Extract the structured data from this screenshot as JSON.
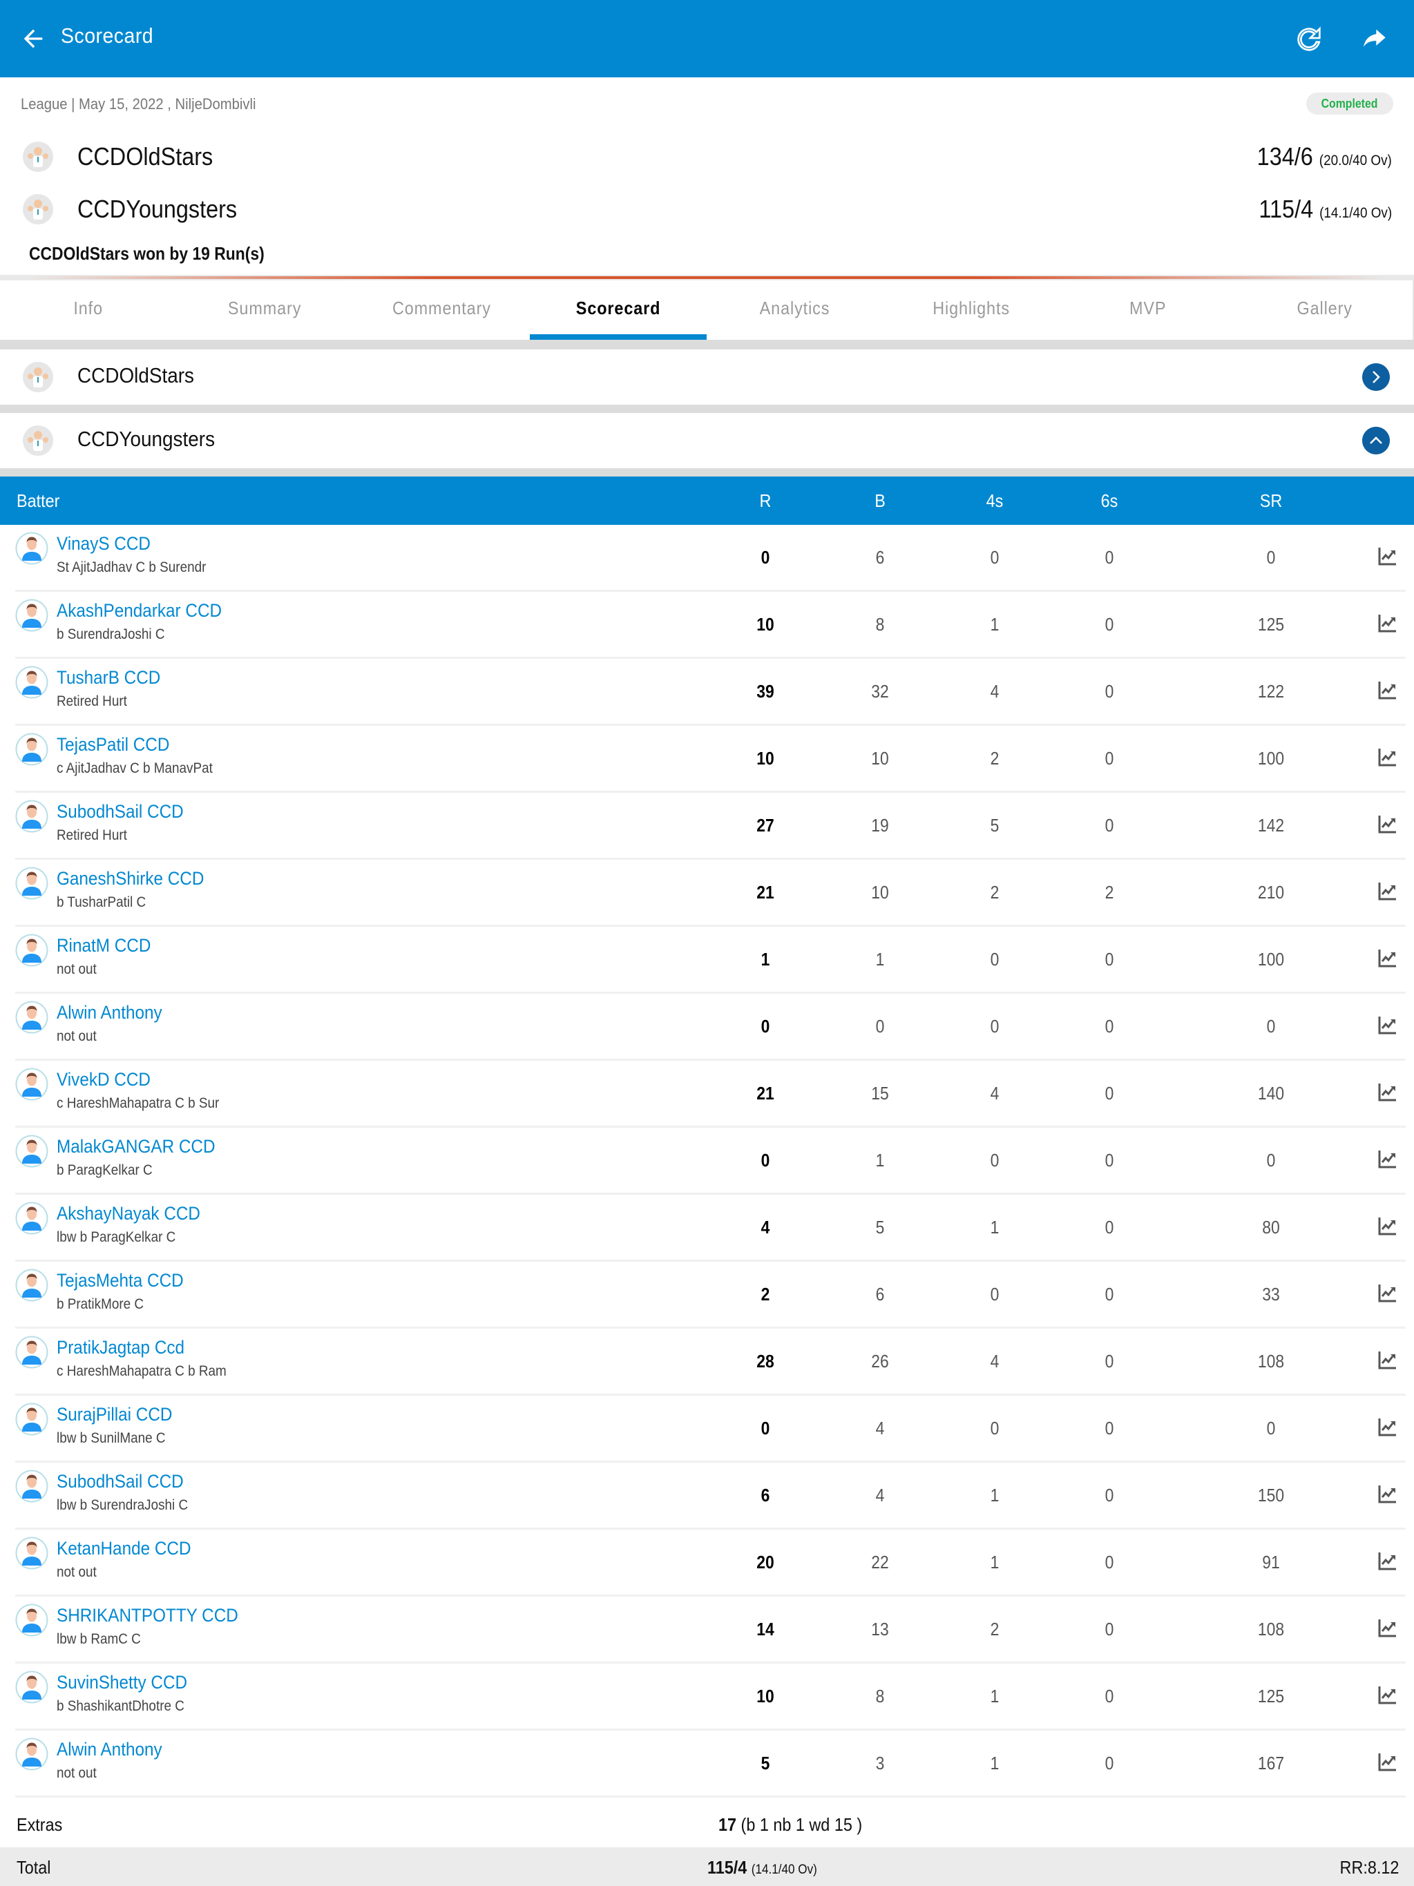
{
  "app_bar": {
    "title": "Scorecard",
    "back_icon": "arrow-left-icon",
    "refresh_icon": "refresh-icon",
    "share_icon": "share-icon"
  },
  "match": {
    "meta": "League | May 15, 2022 , NiljeDombivli",
    "status": "Completed",
    "result": "CCDOldStars won by 19 Run(s)",
    "teams": [
      {
        "name": "CCDOldStars",
        "score": "134/6",
        "overs": "(20.0/40 Ov)"
      },
      {
        "name": "CCDYoungsters",
        "score": "115/4",
        "overs": "(14.1/40 Ov)"
      }
    ]
  },
  "tabs": [
    {
      "label": "Info",
      "active": false
    },
    {
      "label": "Summary",
      "active": false
    },
    {
      "label": "Commentary",
      "active": false
    },
    {
      "label": "Scorecard",
      "active": true
    },
    {
      "label": "Analytics",
      "active": false
    },
    {
      "label": "Highlights",
      "active": false
    },
    {
      "label": "MVP",
      "active": false
    },
    {
      "label": "Gallery",
      "active": false
    }
  ],
  "innings": [
    {
      "team": "CCDOldStars",
      "expanded": false,
      "toggle_icon": "chevron-right-icon"
    },
    {
      "team": "CCDYoungsters",
      "expanded": true,
      "toggle_icon": "chevron-up-icon"
    }
  ],
  "batting_table": {
    "headers": {
      "batter": "Batter",
      "r": "R",
      "b": "B",
      "fours": "4s",
      "sixes": "6s",
      "sr": "SR"
    },
    "rows": [
      {
        "name": "VinayS CCD",
        "dismissal": "St AjitJadhav C b Surendr",
        "r": "0",
        "b": "6",
        "fours": "0",
        "sixes": "0",
        "sr": "0"
      },
      {
        "name": "AkashPendarkar CCD",
        "dismissal": "b SurendraJoshi C",
        "r": "10",
        "b": "8",
        "fours": "1",
        "sixes": "0",
        "sr": "125"
      },
      {
        "name": "TusharB CCD",
        "dismissal": "Retired Hurt",
        "r": "39",
        "b": "32",
        "fours": "4",
        "sixes": "0",
        "sr": "122"
      },
      {
        "name": "TejasPatil CCD",
        "dismissal": "c AjitJadhav C b ManavPat",
        "r": "10",
        "b": "10",
        "fours": "2",
        "sixes": "0",
        "sr": "100"
      },
      {
        "name": "SubodhSail CCD",
        "dismissal": "Retired Hurt",
        "r": "27",
        "b": "19",
        "fours": "5",
        "sixes": "0",
        "sr": "142"
      },
      {
        "name": "GaneshShirke CCD",
        "dismissal": "b TusharPatil C",
        "r": "21",
        "b": "10",
        "fours": "2",
        "sixes": "2",
        "sr": "210"
      },
      {
        "name": "RinatM CCD",
        "dismissal": "not out",
        "r": "1",
        "b": "1",
        "fours": "0",
        "sixes": "0",
        "sr": "100"
      },
      {
        "name": "Alwin Anthony",
        "dismissal": "not out",
        "r": "0",
        "b": "0",
        "fours": "0",
        "sixes": "0",
        "sr": "0"
      },
      {
        "name": "VivekD CCD",
        "dismissal": "c HareshMahapatra C b Sur",
        "r": "21",
        "b": "15",
        "fours": "4",
        "sixes": "0",
        "sr": "140"
      },
      {
        "name": "MalakGANGAR CCD",
        "dismissal": "b ParagKelkar C",
        "r": "0",
        "b": "1",
        "fours": "0",
        "sixes": "0",
        "sr": "0"
      },
      {
        "name": "AkshayNayak CCD",
        "dismissal": "lbw b ParagKelkar C",
        "r": "4",
        "b": "5",
        "fours": "1",
        "sixes": "0",
        "sr": "80"
      },
      {
        "name": "TejasMehta CCD",
        "dismissal": "b PratikMore C",
        "r": "2",
        "b": "6",
        "fours": "0",
        "sixes": "0",
        "sr": "33"
      },
      {
        "name": "PratikJagtap Ccd",
        "dismissal": "c HareshMahapatra C b Ram",
        "r": "28",
        "b": "26",
        "fours": "4",
        "sixes": "0",
        "sr": "108"
      },
      {
        "name": "SurajPillai CCD",
        "dismissal": "lbw b SunilMane C",
        "r": "0",
        "b": "4",
        "fours": "0",
        "sixes": "0",
        "sr": "0"
      },
      {
        "name": "SubodhSail CCD",
        "dismissal": "lbw b SurendraJoshi C",
        "r": "6",
        "b": "4",
        "fours": "1",
        "sixes": "0",
        "sr": "150"
      },
      {
        "name": "KetanHande CCD",
        "dismissal": "not out",
        "r": "20",
        "b": "22",
        "fours": "1",
        "sixes": "0",
        "sr": "91"
      },
      {
        "name": "SHRIKANTPOTTY CCD",
        "dismissal": "lbw b RamC C",
        "r": "14",
        "b": "13",
        "fours": "2",
        "sixes": "0",
        "sr": "108"
      },
      {
        "name": "SuvinShetty CCD",
        "dismissal": "b ShashikantDhotre C",
        "r": "10",
        "b": "8",
        "fours": "1",
        "sixes": "0",
        "sr": "125"
      },
      {
        "name": "Alwin Anthony",
        "dismissal": "not out",
        "r": "5",
        "b": "3",
        "fours": "1",
        "sixes": "0",
        "sr": "167"
      }
    ],
    "extras": {
      "label": "Extras",
      "total": "17",
      "breakdown": "(b 1 nb 1 wd 15 )"
    },
    "total": {
      "label": "Total",
      "score": "115/4",
      "overs": "(14.1/40 Ov)",
      "run_rate": "RR:8.12"
    }
  },
  "colors": {
    "primary": "#0288d1",
    "toggle": "#0d5fa0",
    "status_green": "#22b14c",
    "accent_line": "#d9532b"
  }
}
